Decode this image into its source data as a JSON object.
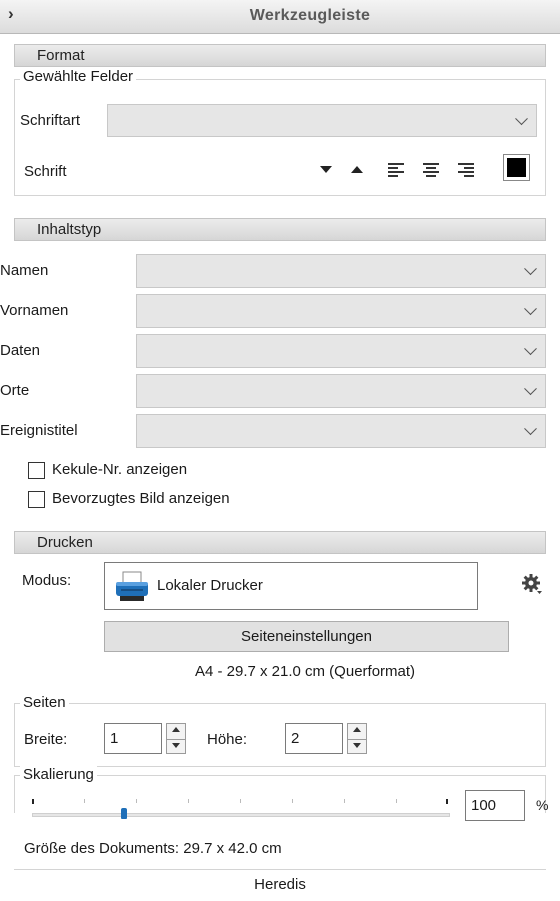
{
  "toolbar": {
    "title": "Werkzeugleiste"
  },
  "format": {
    "header": "Format",
    "group_label": "Gewählte Felder",
    "font_label": "Schriftart",
    "font_value": "",
    "text_label": "Schrift"
  },
  "content": {
    "header": "Inhaltstyp",
    "rows": [
      {
        "label": "Namen",
        "value": ""
      },
      {
        "label": "Vornamen",
        "value": ""
      },
      {
        "label": "Daten",
        "value": ""
      },
      {
        "label": "Orte",
        "value": ""
      },
      {
        "label": "Ereignistitel",
        "value": ""
      }
    ],
    "checkboxes": [
      {
        "label": "Kekule-Nr. anzeigen",
        "checked": false
      },
      {
        "label": "Bevorzugtes Bild anzeigen",
        "checked": false
      }
    ]
  },
  "print": {
    "header": "Drucken",
    "mode_label": "Modus:",
    "mode_value": "Lokaler Drucker",
    "page_setup_button": "Seiteneinstellungen",
    "paper_info": "A4 - 29.7 x 21.0 cm (Querformat)",
    "pages_label": "Seiten",
    "width_label": "Breite:",
    "width_value": "1",
    "height_label": "Höhe:",
    "height_value": "2",
    "scaling_label": "Skalierung",
    "scaling_value": "100",
    "scaling_unit": "%",
    "scaling_slider_fraction": 0.22,
    "document_size": "Größe des Dokuments: 29.7 x 42.0 cm"
  },
  "footer": {
    "app_name": "Heredis"
  },
  "colors": {
    "printer_blue": "#1f6fb8",
    "slider_thumb": "#1f6fb8",
    "color_swatch": "#000000"
  }
}
